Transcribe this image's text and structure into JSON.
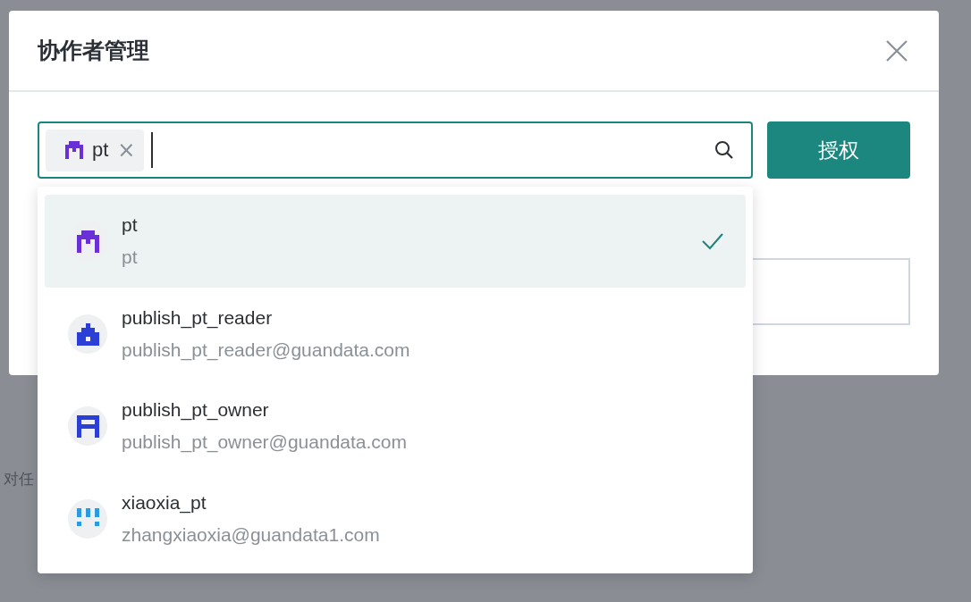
{
  "background": {
    "text": "对任"
  },
  "dialog": {
    "title": "协作者管理"
  },
  "search": {
    "tags": [
      {
        "label": "pt",
        "remove": "×",
        "color": "#6a2fd6"
      }
    ]
  },
  "authorize_button": "授权",
  "dropdown": {
    "options": [
      {
        "name": "pt",
        "email": "pt",
        "selected": true,
        "color": "#6a2fd6"
      },
      {
        "name": "publish_pt_reader",
        "email": "publish_pt_reader@guandata.com",
        "selected": false,
        "color": "#2b3fd6"
      },
      {
        "name": "publish_pt_owner",
        "email": "publish_pt_owner@guandata.com",
        "selected": false,
        "color": "#2b3fd6"
      },
      {
        "name": "xiaoxia_pt",
        "email": "zhangxiaoxia@guandata1.com",
        "selected": false,
        "color": "#2c9ae0"
      }
    ]
  }
}
